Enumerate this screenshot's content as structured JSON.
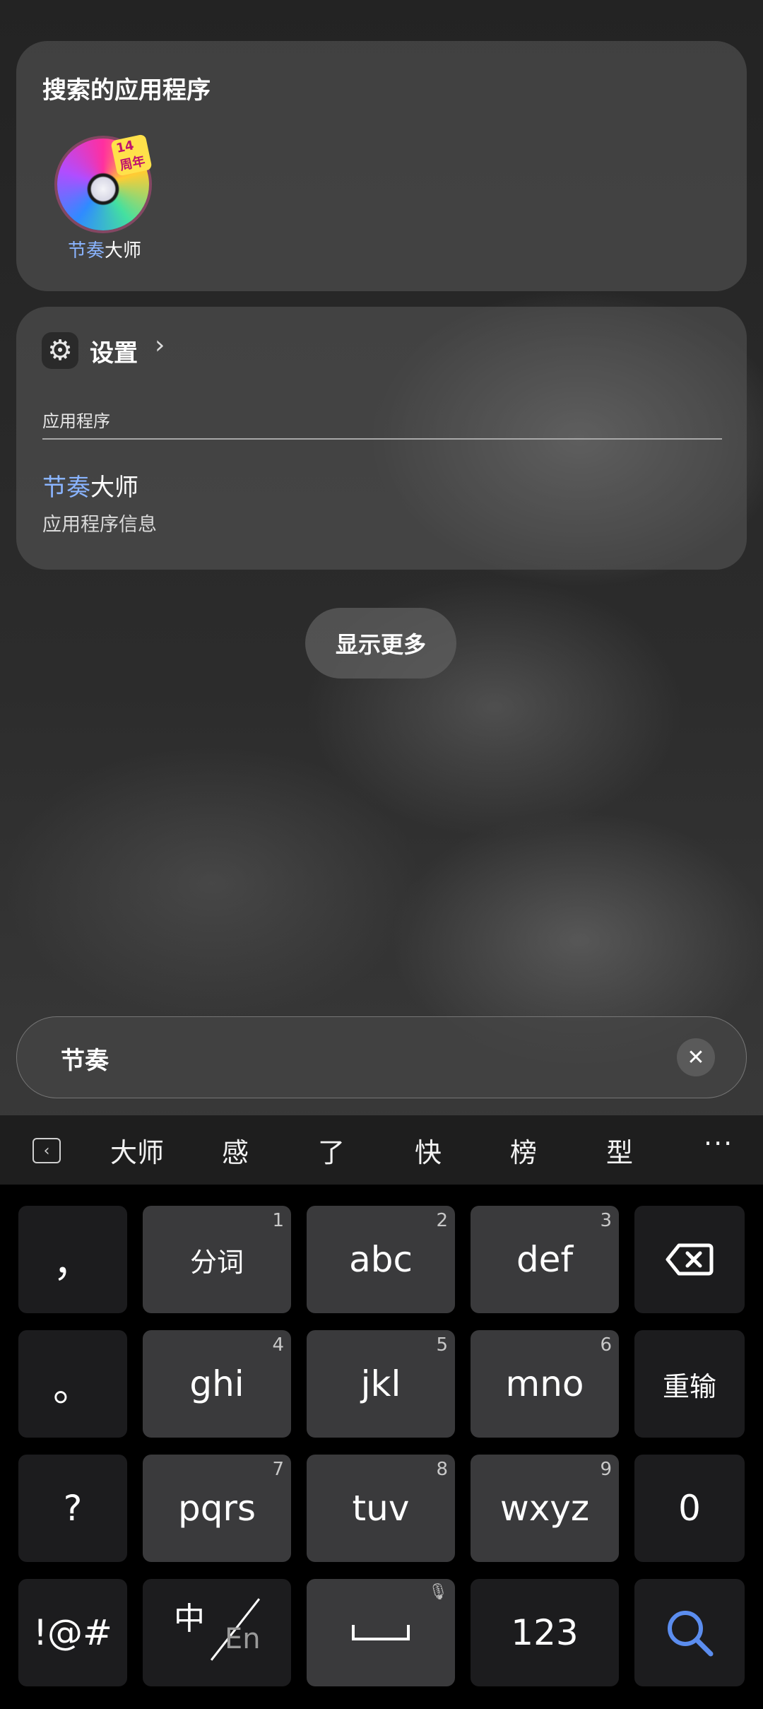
{
  "apps_card": {
    "title": "搜索的应用程序",
    "app": {
      "label_highlight": "节奏",
      "label_rest": "大师",
      "icon": "rhythm-master-app-icon",
      "badge": "14周年"
    }
  },
  "settings_card": {
    "title": "设置",
    "section_label": "应用程序",
    "result": {
      "title_highlight": "节奏",
      "title_rest": "大师",
      "subtitle": "应用程序信息"
    }
  },
  "show_more_label": "显示更多",
  "search": {
    "value": "节奏"
  },
  "candidates": [
    "大师",
    "感",
    "了",
    "快",
    "榜",
    "型"
  ],
  "keyboard": {
    "row1": {
      "left": "，",
      "k1": {
        "label": "分词",
        "num": "1"
      },
      "k2": {
        "label": "abc",
        "num": "2"
      },
      "k3": {
        "label": "def",
        "num": "3"
      }
    },
    "row2": {
      "left": "。",
      "k1": {
        "label": "ghi",
        "num": "4"
      },
      "k2": {
        "label": "jkl",
        "num": "5"
      },
      "k3": {
        "label": "mno",
        "num": "6"
      },
      "right": "重输"
    },
    "row3": {
      "left": "?",
      "k1": {
        "label": "pqrs",
        "num": "7"
      },
      "k2": {
        "label": "tuv",
        "num": "8"
      },
      "k3": {
        "label": "wxyz",
        "num": "9"
      },
      "right": "0"
    },
    "row4": {
      "left": "!@#",
      "zh": "中",
      "en": "En",
      "num_switch": "123"
    }
  },
  "colors": {
    "highlight": "#8ab4ff",
    "search_key": "#5b8def"
  }
}
